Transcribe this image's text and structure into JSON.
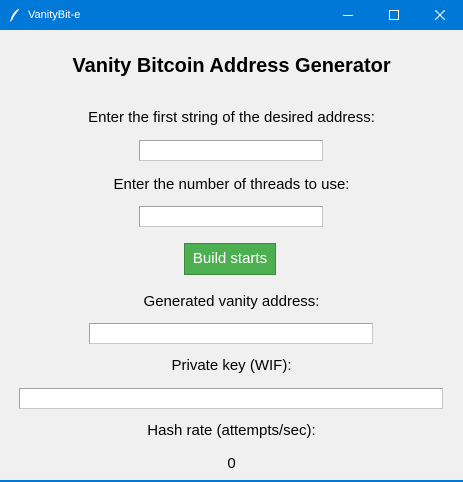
{
  "window": {
    "title": "VanityBit-e",
    "accent_color": "#0078d7",
    "controls": {
      "minimize_icon": "minimize-icon",
      "maximize_icon": "maximize-icon",
      "close_icon": "close-icon"
    }
  },
  "main": {
    "heading": "Vanity Bitcoin Address Generator",
    "prefix_label": "Enter the first string of the desired address:",
    "prefix_value": "",
    "threads_label": "Enter the number of threads to use:",
    "threads_value": "",
    "build_button_label": "Build starts",
    "build_button_color": "#4caf50",
    "address_label": "Generated vanity address:",
    "address_value": "",
    "private_key_label": "Private key (WIF):",
    "private_key_value": "",
    "hash_rate_label": "Hash rate (attempts/sec):",
    "hash_rate_value": "0"
  }
}
